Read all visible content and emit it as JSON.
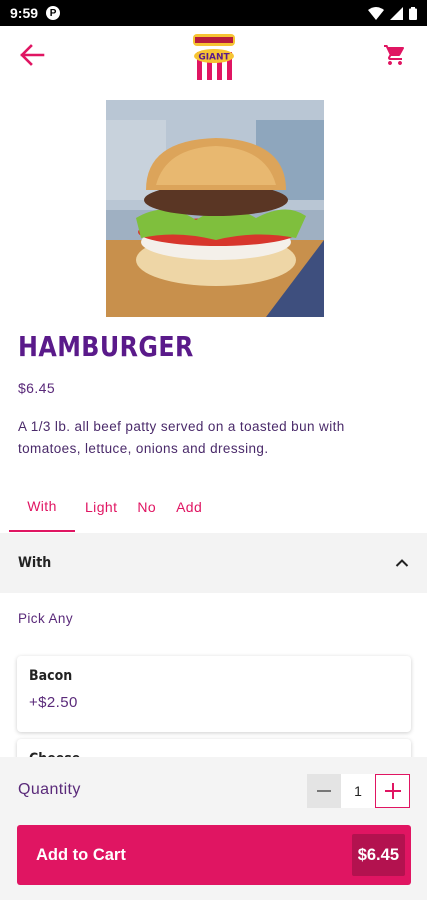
{
  "status_bar": {
    "time": "9:59",
    "app_icon_letter": "P"
  },
  "header": {
    "logo_top_text": "BIG DADDY'S",
    "logo_main_text": "GIANT"
  },
  "product": {
    "title": "HAMBURGER",
    "price": "$6.45",
    "description": "A 1/3 lb. all beef patty served on a toasted bun with tomatoes, lettuce, onions and dressing."
  },
  "tabs": [
    {
      "label": "With",
      "active": true
    },
    {
      "label": "Light",
      "active": false
    },
    {
      "label": "No",
      "active": false
    },
    {
      "label": "Add",
      "active": false
    }
  ],
  "section": {
    "title": "With",
    "hint": "Pick Any"
  },
  "options": [
    {
      "name": "Bacon",
      "price": "+$2.50"
    },
    {
      "name": "Cheese",
      "price": ""
    }
  ],
  "bottom": {
    "quantity_label": "Quantity",
    "quantity_value": "1",
    "add_to_cart_label": "Add to Cart",
    "total_price": "$6.45"
  },
  "colors": {
    "accent": "#e01562",
    "title_purple": "#5a1a8a",
    "text_purple": "#5a2a7a"
  }
}
